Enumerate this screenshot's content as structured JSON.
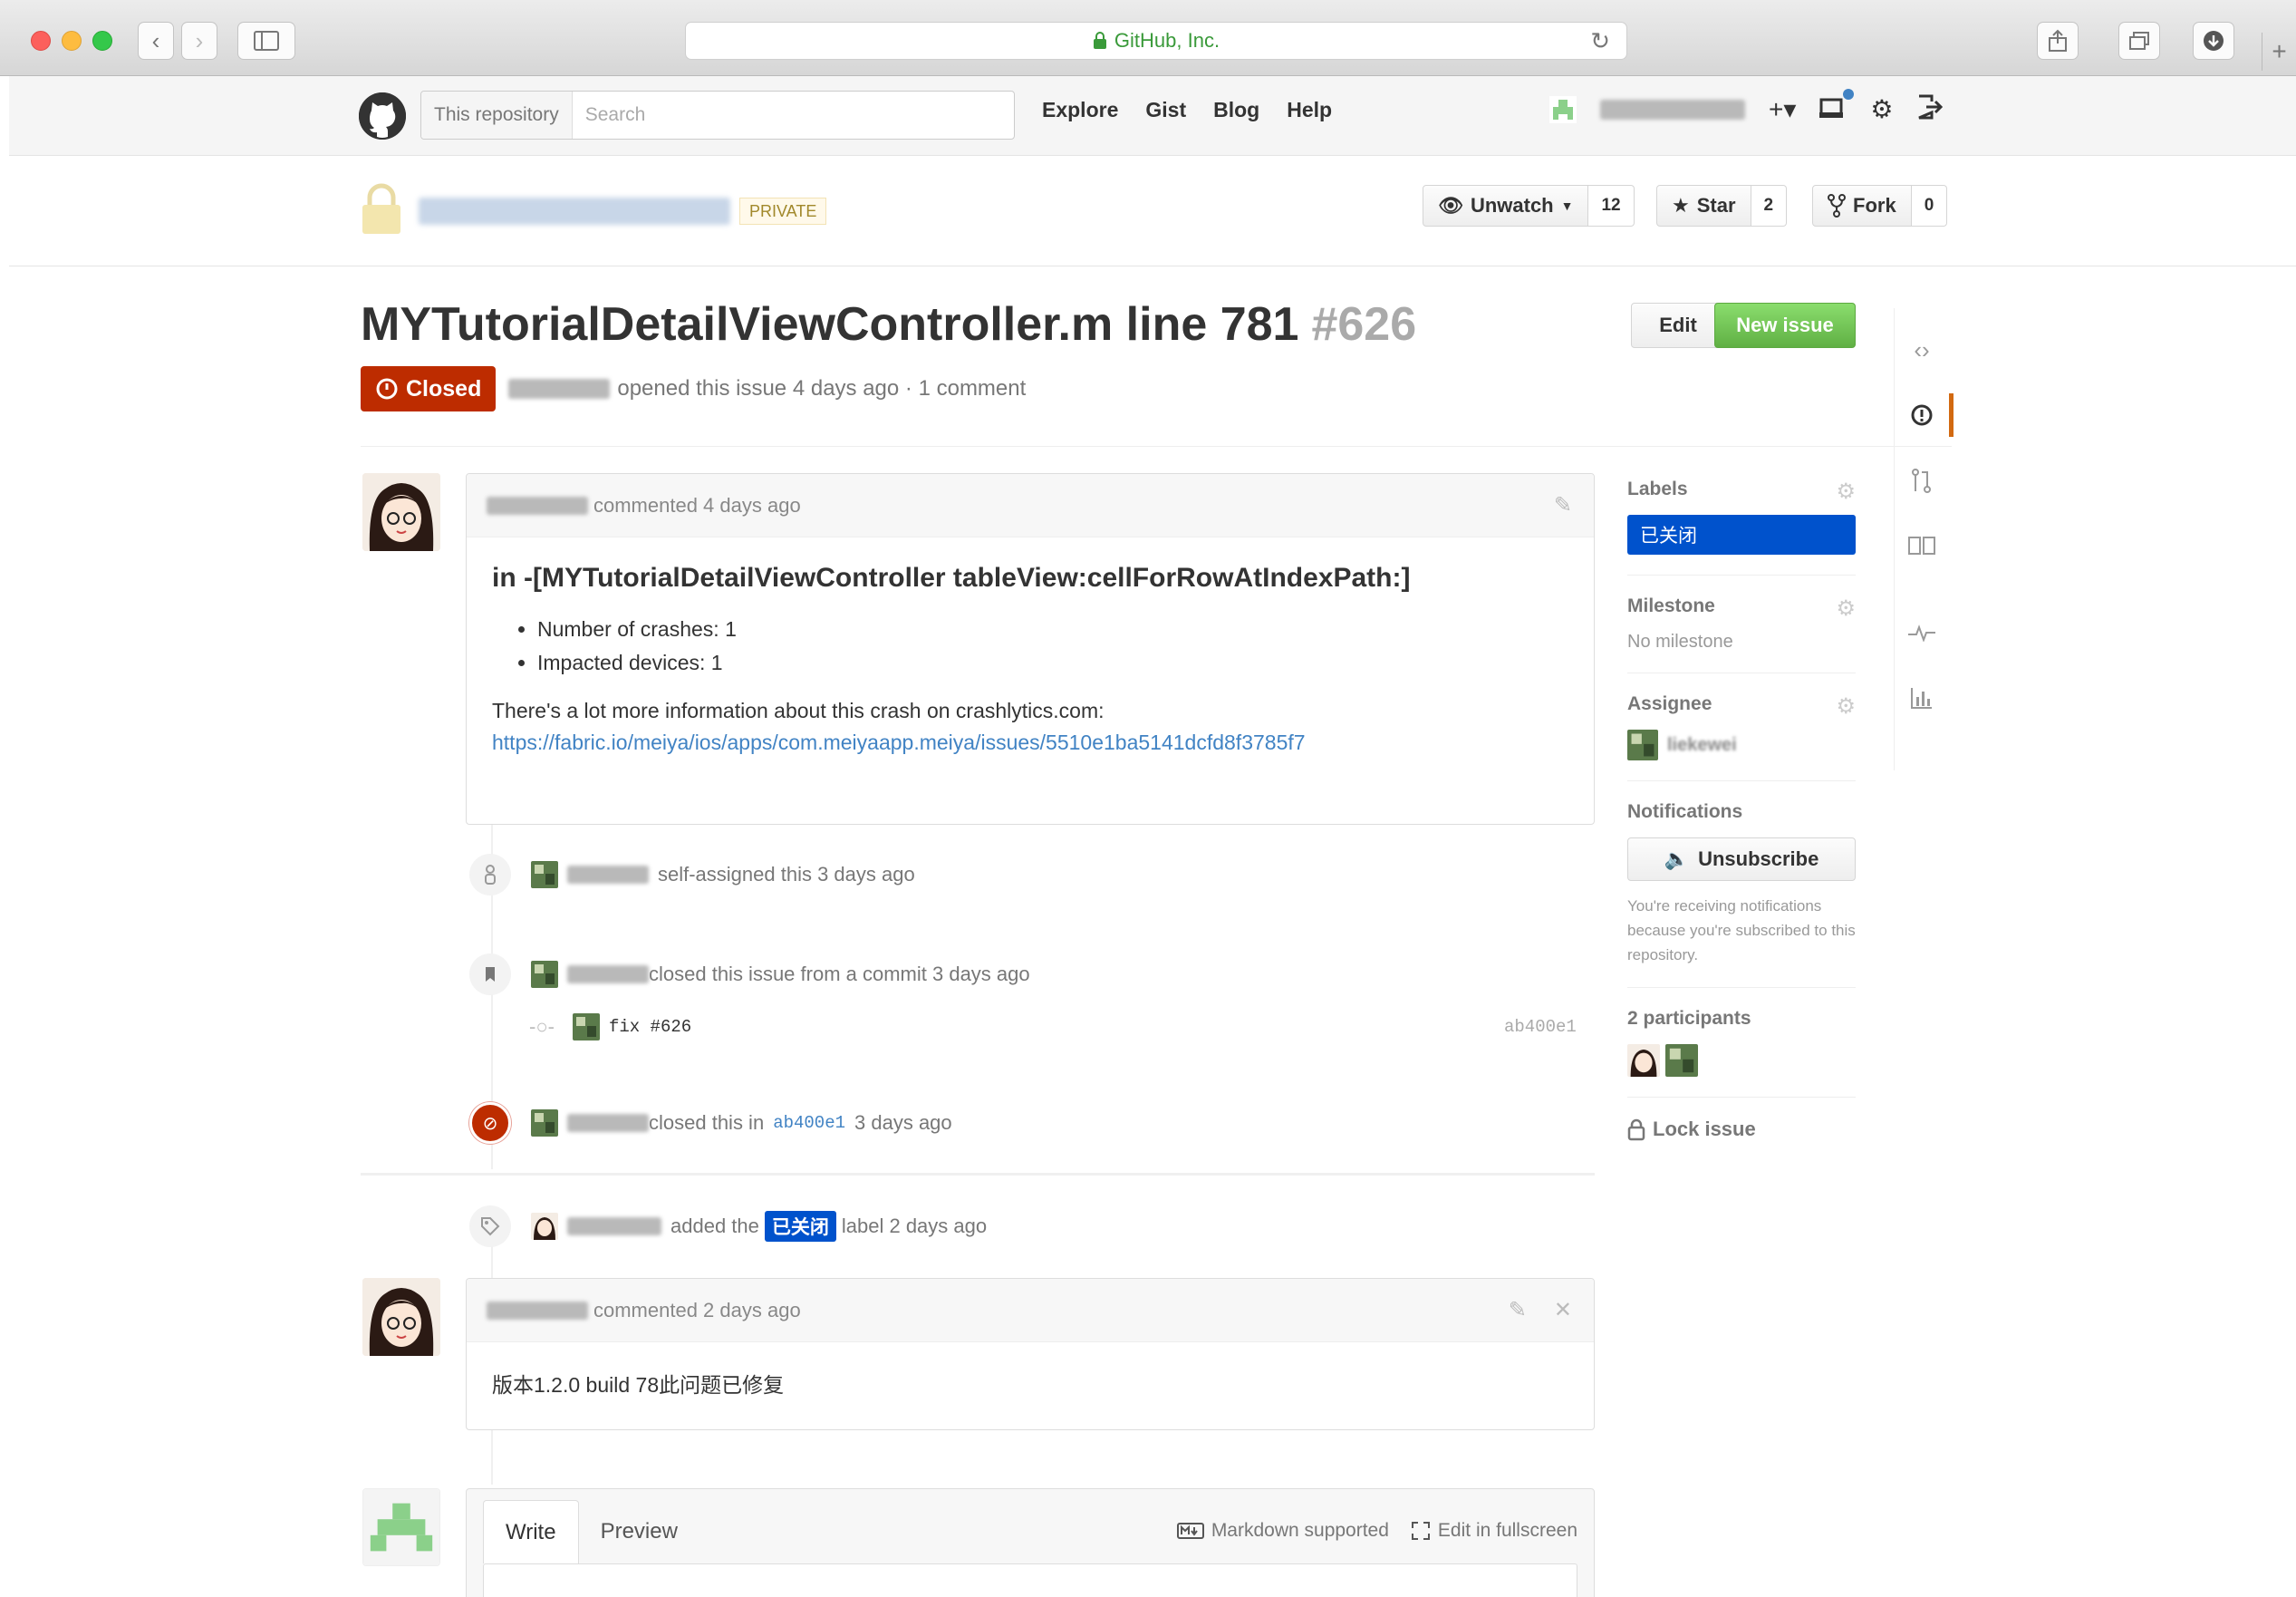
{
  "browser": {
    "url_label": "GitHub, Inc.",
    "reload_icon": "reload-icon"
  },
  "header": {
    "search_scope": "This repository",
    "search_placeholder": "Search",
    "nav": [
      "Explore",
      "Gist",
      "Blog",
      "Help"
    ],
    "plus_label": "+▾"
  },
  "repo": {
    "private_badge": "PRIVATE",
    "unwatch_label": "Unwatch",
    "watch_count": "12",
    "star_label": "Star",
    "star_count": "2",
    "fork_label": "Fork",
    "fork_count": "0"
  },
  "issue": {
    "title": "MYTutorialDetailViewController.m line 781",
    "number": "#626",
    "edit_label": "Edit",
    "new_issue_label": "New issue",
    "state": "Closed",
    "meta": "opened this issue 4 days ago · 1 comment"
  },
  "comments": [
    {
      "header": "commented 4 days ago",
      "heading": "in -[MYTutorialDetailViewController tableView:cellForRowAtIndexPath:]",
      "bullets": [
        "Number of crashes: 1",
        "Impacted devices: 1"
      ],
      "paragraph": "There's a lot more information about this crash on crashlytics.com:",
      "link": "https://fabric.io/meiya/ios/apps/com.meiyaapp.meiya/issues/5510e1ba5141dcfd8f3785f7"
    },
    {
      "header": "commented 2 days ago",
      "body": "版本1.2.0 build 78此问题已修复"
    }
  ],
  "events": {
    "self_assigned": "self-assigned this 3 days ago",
    "closed_from_commit": "closed this issue from a commit 3 days ago",
    "commit_message": "fix #626",
    "commit_sha": "ab400e1",
    "closed_in_prefix": "closed this in",
    "closed_in_sha": "ab400e1",
    "closed_in_suffix": "3 days ago",
    "label_prefix": "added the",
    "label_name": "已关闭",
    "label_suffix": "label 2 days ago"
  },
  "composer": {
    "tab_write": "Write",
    "tab_preview": "Preview",
    "markdown": "Markdown supported",
    "fullscreen": "Edit in fullscreen"
  },
  "sidebar": {
    "labels_title": "Labels",
    "label_value": "已关闭",
    "milestone_title": "Milestone",
    "milestone_value": "No milestone",
    "assignee_title": "Assignee",
    "assignee_name": "liekewei",
    "notifications_title": "Notifications",
    "unsubscribe_label": "Unsubscribe",
    "notifications_note": "You're receiving notifications because you're subscribed to this repository.",
    "participants_title": "2 participants",
    "lock_label": "Lock issue"
  },
  "colors": {
    "closed_red": "#bd2c00",
    "label_blue": "#0052cc",
    "new_issue_green": "#6cc644",
    "link_blue": "#4183c4",
    "private_badge": "#fff9ea",
    "active_tab_orange": "#d26911"
  }
}
